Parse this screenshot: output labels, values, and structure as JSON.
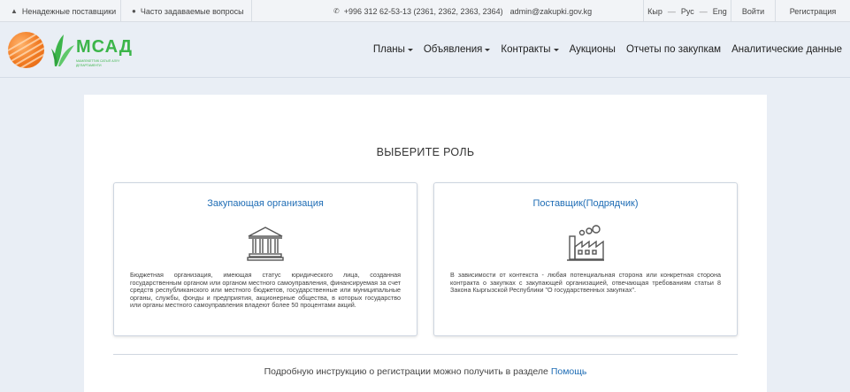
{
  "topbar": {
    "unreliable_suppliers": "Ненадежные поставщики",
    "faq": "Часто задаваемые вопросы",
    "phone": "+996 312 62-53-13 (2361, 2362, 2363, 2364)",
    "email": "admin@zakupki.gov.kg",
    "languages": [
      "Кыр",
      "Рус",
      "Eng"
    ],
    "login": "Войти",
    "register": "Регистрация"
  },
  "logo": {
    "name": "МСАД",
    "subtitle": "МАМЛЕКЕТТИК САТЫП АЛУУ ДЕПАРТАМЕНТИ"
  },
  "nav": {
    "items": [
      {
        "label": "Планы",
        "dropdown": true
      },
      {
        "label": "Объявления",
        "dropdown": true
      },
      {
        "label": "Контракты",
        "dropdown": true
      },
      {
        "label": "Аукционы",
        "dropdown": false
      },
      {
        "label": "Отчеты по закупкам",
        "dropdown": false
      },
      {
        "label": "Аналитические данные",
        "dropdown": false
      }
    ]
  },
  "main": {
    "title": "ВЫБЕРИТЕ РОЛЬ",
    "cards": {
      "buyer": {
        "title": "Закупающая организация",
        "icon": "government-building-icon",
        "description": "Бюджетная организация, имеющая статус юридического лица, созданная государственным органом или органом местного самоуправления, финансируемая за счет средств республиканского или местного бюджетов, государственные или муниципальные органы, службы, фонды и предприятия, акционерные общества, в которых государство или органы местного самоуправления владеют более 50 процентами акций."
      },
      "supplier": {
        "title": "Поставщик(Подрядчик)",
        "icon": "factory-icon",
        "description": "В зависимости от контекста - любая потенциальная сторона или конкретная сторона контракта о закупках с закупающей организацией, отвечающая требованиям статьи 8 Закона Кыргызской Республики \"О государственных закупках\"."
      }
    },
    "footer_text": "Подробную инструкцию о регистрации можно получить в разделе",
    "help_link": "Помощь"
  },
  "colors": {
    "accent": "#1f6db5",
    "logo_green": "#3cb54a",
    "logo_orange": "#f07a22",
    "background": "#e9eef5"
  }
}
